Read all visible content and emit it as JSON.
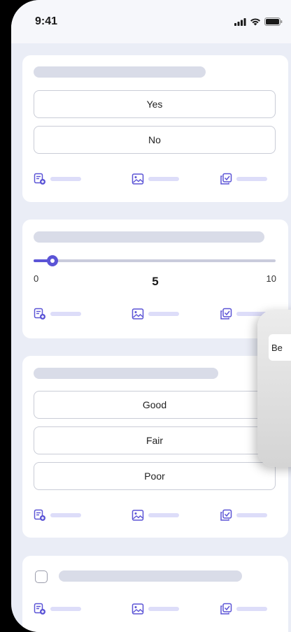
{
  "status_bar": {
    "time": "9:41",
    "signal_icon": "cellular-signal-icon",
    "wifi_icon": "wifi-icon",
    "battery_icon": "battery-icon"
  },
  "card1": {
    "options": [
      "Yes",
      "No"
    ]
  },
  "card2": {
    "slider": {
      "min": "0",
      "max": "10",
      "value": "5",
      "fill_fraction": 0.05
    }
  },
  "card3": {
    "options": [
      "Good",
      "Fair",
      "Poor"
    ]
  },
  "toolbar_icons": {
    "add_note": "add-note-icon",
    "image": "image-icon",
    "copy_check": "copy-check-icon"
  },
  "popover": {
    "chip_text": "Be"
  },
  "colors": {
    "accent": "#5b54d6",
    "background": "#eaedf6",
    "skeleton": "#d9dce8",
    "tool_line": "#ddddf9"
  }
}
